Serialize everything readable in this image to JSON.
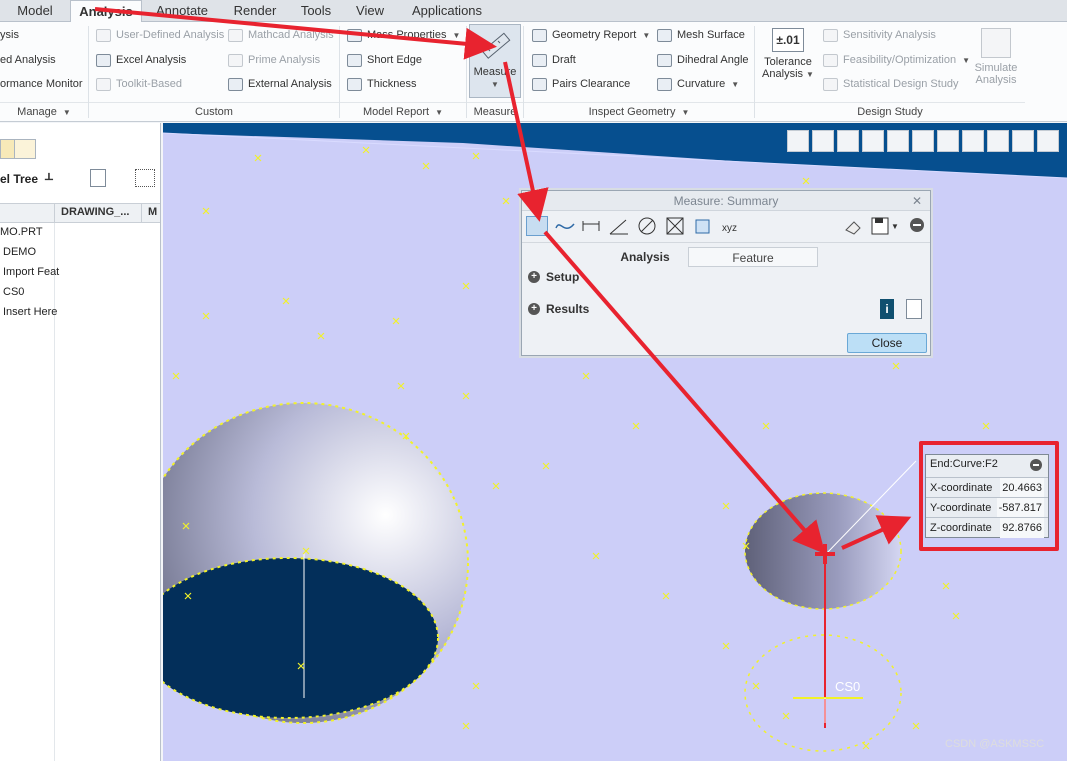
{
  "menu": {
    "tabs": [
      "Model",
      "Analysis",
      "Annotate",
      "Render",
      "Tools",
      "View",
      "Applications"
    ],
    "active_tab": "Analysis"
  },
  "ribbon": {
    "manage": {
      "items": [
        "ysis",
        "ed Analysis",
        "ormance Monitor"
      ],
      "group_label": "Manage"
    },
    "custom": {
      "col1": [
        "User-Defined Analysis",
        "Excel Analysis",
        "Toolkit-Based"
      ],
      "col2": [
        "Mathcad Analysis",
        "Prime Analysis",
        "External Analysis"
      ],
      "group_label": "Custom"
    },
    "model_report": {
      "items": [
        "Mass Properties",
        "Short Edge",
        "Thickness"
      ],
      "group_label": "Model Report"
    },
    "measure": {
      "label": "Measure",
      "group_label": "Measure"
    },
    "inspect_geometry": {
      "col1": [
        "Geometry Report",
        "Draft",
        "Pairs Clearance"
      ],
      "col2": [
        "Mesh Surface",
        "Dihedral Angle",
        "Curvature"
      ],
      "group_label": "Inspect Geometry"
    },
    "design_study": {
      "tolerance_icon": "±.01",
      "tolerance_label_1": "Tolerance",
      "tolerance_label_2": "Analysis",
      "items": [
        "Sensitivity Analysis",
        "Feasibility/Optimization",
        "Statistical Design Study"
      ],
      "simulate_1": "Simulate",
      "simulate_2": "Analysis",
      "group_label": "Design Study"
    }
  },
  "left_panel": {
    "tree_label": "el Tree",
    "col_drawing": "DRAWING_...",
    "col_m": "M",
    "rows": [
      "MO.PRT",
      "DEMO",
      "Import Feat",
      "CS0",
      "Insert Here"
    ]
  },
  "measure_dialog": {
    "title": "Measure: Summary",
    "tabs": [
      "Analysis",
      "Feature"
    ],
    "sections": [
      "Setup",
      "Results"
    ],
    "close_label": "Close"
  },
  "point_info": {
    "title": "End:Curve:F2",
    "rows": [
      {
        "label": "X-coordinate",
        "value": "20.4663"
      },
      {
        "label": "Y-coordinate",
        "value": "-587.817"
      },
      {
        "label": "Z-coordinate",
        "value": "92.8766"
      }
    ]
  },
  "viewport": {
    "cs_label": "CS0"
  },
  "watermark": "CSDN @ASKMSSC",
  "colors": {
    "accent_red": "#e8232f",
    "model_surface": "#cccef8",
    "top_face": "#064f8f",
    "highlight_yellow": "#f2f229"
  }
}
